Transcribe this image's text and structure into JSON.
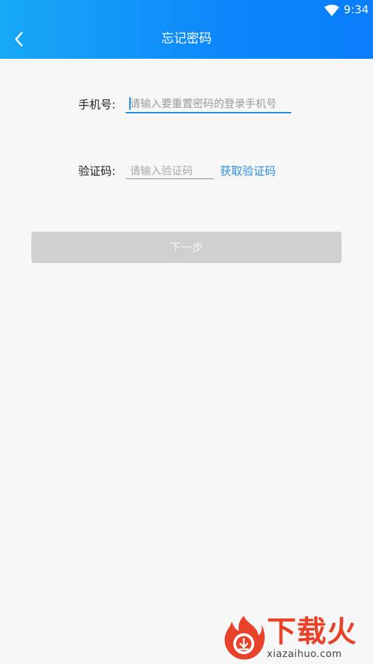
{
  "status_bar": {
    "time": "9:34",
    "icons": [
      "wifi-icon"
    ]
  },
  "header": {
    "title": "忘记密码",
    "back_icon": "chevron-left-icon"
  },
  "form": {
    "phone": {
      "label": "手机号:",
      "placeholder": "请输入要重置密码的登录手机号",
      "value": ""
    },
    "code": {
      "label": "验证码:",
      "placeholder": "请输入验证码",
      "value": "",
      "action_label": "获取验证码"
    }
  },
  "next_button": {
    "label": "下一步",
    "enabled": false
  },
  "watermark": {
    "brand": "下载火",
    "url": "xiazaihuo.com"
  },
  "colors": {
    "header_start": "#17a9f6",
    "header_end": "#0a7dfb",
    "accent": "#2a8ee8",
    "button_disabled": "#cfcfcf",
    "background": "#f7f7f7",
    "watermark_red": "#e8432a"
  }
}
